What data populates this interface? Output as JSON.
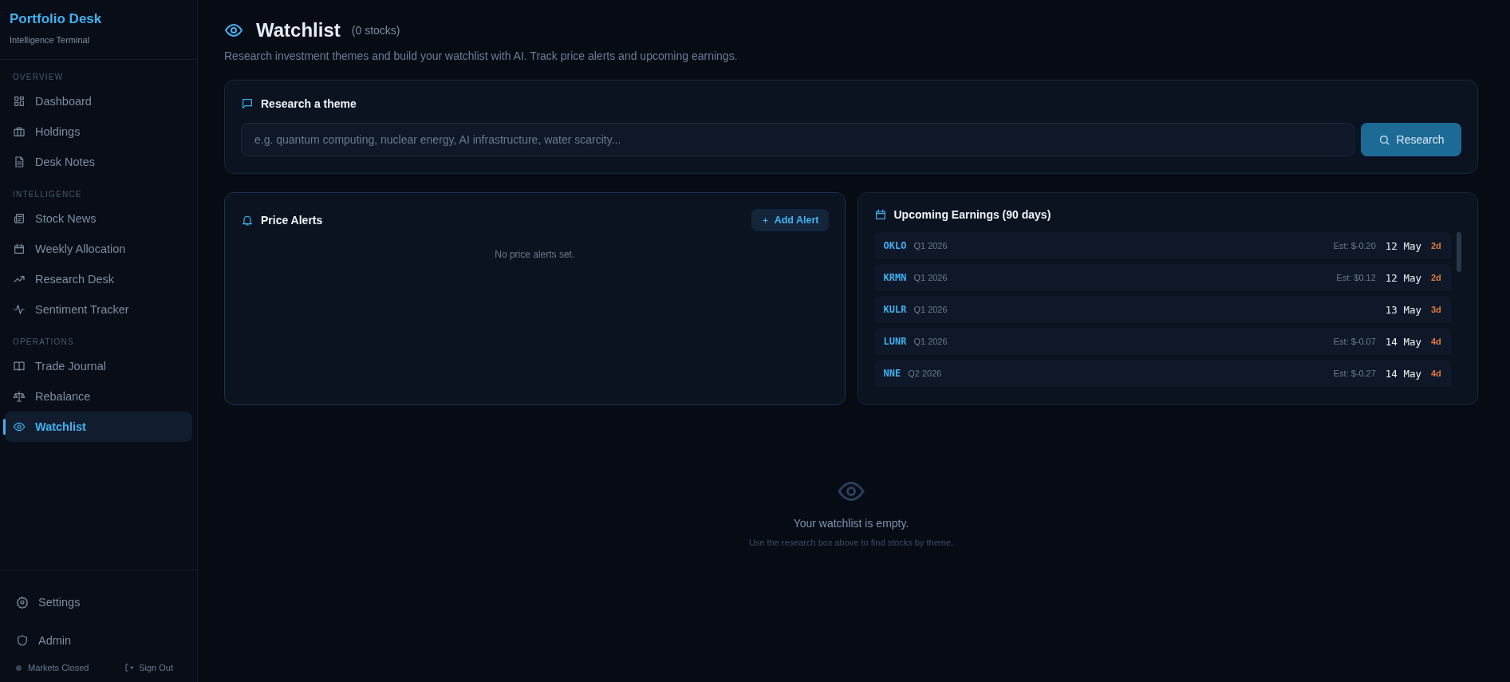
{
  "sidebar": {
    "brand": "Portfolio Desk",
    "tagline": "Intelligence Terminal",
    "sections": [
      {
        "heading": "OVERVIEW",
        "items": [
          {
            "label": "Dashboard",
            "selected": false
          },
          {
            "label": "Holdings",
            "selected": false
          },
          {
            "label": "Desk Notes",
            "selected": false
          }
        ]
      },
      {
        "heading": "INTELLIGENCE",
        "items": [
          {
            "label": "Stock News",
            "selected": false
          },
          {
            "label": "Weekly Allocation",
            "selected": false
          },
          {
            "label": "Research Desk",
            "selected": false
          },
          {
            "label": "Sentiment Tracker",
            "selected": false
          }
        ]
      },
      {
        "heading": "OPERATIONS",
        "items": [
          {
            "label": "Trade Journal",
            "selected": false
          },
          {
            "label": "Rebalance",
            "selected": false
          },
          {
            "label": "Watchlist",
            "selected": true
          }
        ]
      }
    ],
    "footer_items": [
      {
        "label": "Settings"
      },
      {
        "label": "Admin"
      }
    ],
    "market_status": "Markets Closed",
    "sign_out": "Sign Out"
  },
  "page": {
    "title": "Watchlist",
    "count": "(0 stocks)",
    "subtitle": "Research investment themes and build your watchlist with AI. Track price alerts and upcoming earnings."
  },
  "research": {
    "title": "Research a theme",
    "placeholder": "e.g. quantum computing, nuclear energy, AI infrastructure, water scarcity...",
    "button": "Research"
  },
  "price_alerts": {
    "title": "Price Alerts",
    "add_button": "Add Alert",
    "empty": "No price alerts set."
  },
  "earnings": {
    "title": "Upcoming Earnings (90 days)",
    "rows": [
      {
        "ticker": "OKLO",
        "quarter": "Q1 2026",
        "estimate": "Est: $-0.20",
        "date": "12 May",
        "days": "2d"
      },
      {
        "ticker": "KRMN",
        "quarter": "Q1 2026",
        "estimate": "Est: $0.12",
        "date": "12 May",
        "days": "2d"
      },
      {
        "ticker": "KULR",
        "quarter": "Q1 2026",
        "date": "13 May",
        "days": "3d"
      },
      {
        "ticker": "LUNR",
        "quarter": "Q1 2026",
        "estimate": "Est: $-0.07",
        "date": "14 May",
        "days": "4d"
      },
      {
        "ticker": "NNE",
        "quarter": "Q2 2026",
        "estimate": "Est: $-0.27",
        "date": "14 May",
        "days": "4d"
      }
    ]
  },
  "empty_state": {
    "title": "Your watchlist is empty.",
    "hint": "Use the research box above to find stocks by theme."
  }
}
